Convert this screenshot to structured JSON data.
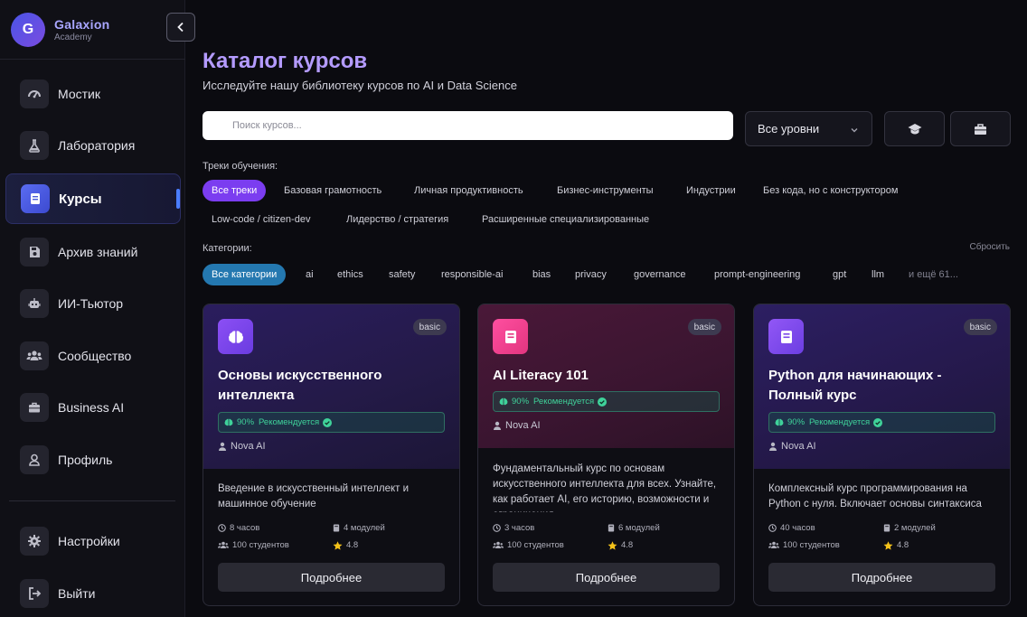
{
  "brand": {
    "initial": "G",
    "name": "Galaxion",
    "subtitle": "Academy"
  },
  "sidebar": {
    "items": [
      {
        "label": "Мостик",
        "icon": "gauge-icon"
      },
      {
        "label": "Лаборатория",
        "icon": "flask-icon"
      },
      {
        "label": "Курсы",
        "icon": "book-icon",
        "active": true
      },
      {
        "label": "Архив знаний",
        "icon": "save-icon"
      },
      {
        "label": "ИИ-Тьютор",
        "icon": "robot-icon"
      },
      {
        "label": "Сообщество",
        "icon": "users-icon"
      },
      {
        "label": "Business AI",
        "icon": "briefcase-icon"
      },
      {
        "label": "Профиль",
        "icon": "user-icon"
      }
    ],
    "bottom": [
      {
        "label": "Настройки",
        "icon": "gear-icon"
      },
      {
        "label": "Выйти",
        "icon": "logout-icon"
      }
    ]
  },
  "main": {
    "title": "Каталог курсов",
    "subtitle": "Исследуйте нашу библиотеку курсов по AI и Data Science",
    "search_placeholder": "Поиск курсов...",
    "level_select": "Все уровни",
    "tracks_label": "Треки обучения:",
    "tracks": [
      "Все треки",
      "Базовая грамотность",
      "Личная продуктивность",
      "Бизнес-инструменты",
      "Индустрии",
      "Без кода, но с конструктором",
      "Low-code / citizen-dev",
      "Лидерство / стратегия",
      "Расширенные специализированные"
    ],
    "categories_label": "Категории:",
    "reset": "Сбросить",
    "categories": [
      "Все категории",
      "ai",
      "ethics",
      "safety",
      "responsible-ai",
      "bias",
      "privacy",
      "governance",
      "prompt-engineering",
      "gpt",
      "llm",
      "и ещё 61..."
    ]
  },
  "courses": [
    {
      "level": "basic",
      "title": "Основы искусственного интеллекта",
      "match_pct": "90%",
      "recommend": "Рекомендуется",
      "author": "Nova AI",
      "description": "Введение в искусственный интеллект и машинное обучение",
      "hours": "8 часов",
      "modules": "4 модулей",
      "students": "100 студентов",
      "rating": "4.8",
      "button": "Подробнее",
      "icon": "brain-icon"
    },
    {
      "level": "basic",
      "title": "AI Literacy 101",
      "match_pct": "90%",
      "recommend": "Рекомендуется",
      "author": "Nova AI",
      "description": "Фундаментальный курс по основам искусственного интеллекта для всех. Узнайте, как работает AI, его историю, возможности и ограничения",
      "hours": "3 часов",
      "modules": "6 модулей",
      "students": "100 студентов",
      "rating": "4.8",
      "button": "Подробнее",
      "icon": "book-icon"
    },
    {
      "level": "basic",
      "title": "Python для начинающих - Полный курс",
      "match_pct": "90%",
      "recommend": "Рекомендуется",
      "author": "Nova AI",
      "description": "Комплексный курс программирования на Python с нуля. Включает основы синтаксиса",
      "hours": "40 часов",
      "modules": "2 модулей",
      "students": "100 студентов",
      "rating": "4.8",
      "button": "Подробнее",
      "icon": "book-icon"
    }
  ],
  "colors": {
    "accent_purple": "#7b3df0",
    "accent_blue": "#2478b0",
    "title_purple": "#b49bff",
    "recommend_green": "#3fd29a"
  }
}
